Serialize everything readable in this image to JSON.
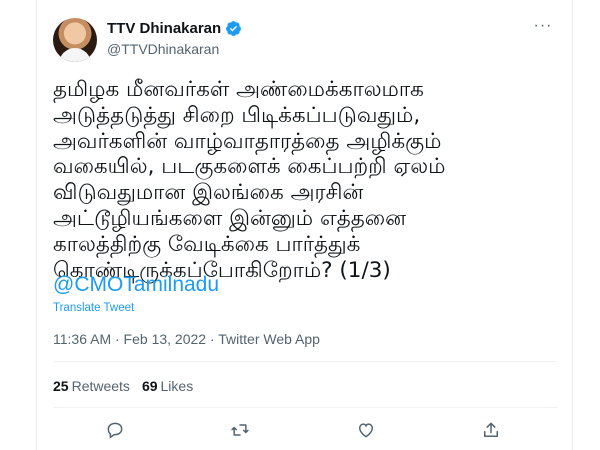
{
  "user": {
    "display_name": "TTV Dhinakaran",
    "handle": "@TTVDhinakaran"
  },
  "tweet": {
    "text": "தமிழக மீனவர்கள் அண்மைக்காலமாக\nஅடுத்தடுத்து சிறை பிடிக்கப்படுவதும்,\nஅவர்களின் வாழ்வாதாரத்தை அழிக்கும்\nவகையில், படகுகளைக் கைப்பற்றி ஏலம்\nவிடுவதுமான இலங்கை அரசின்\nஅட்டூழியங்களை இன்னும் எத்தனை\nகாலத்திற்கு வேடிக்கை பார்த்துக்\nகொண்டிருக்கப்போகிறோம்? (1/3)",
    "mention": "@CMOTamilnadu",
    "translate_label": "Translate Tweet",
    "meta": "11:36 AM · Feb 13, 2022 · Twitter Web App"
  },
  "stats": {
    "retweets_count": "25",
    "retweets_label": "Retweets",
    "likes_count": "69",
    "likes_label": "Likes"
  },
  "icons": {
    "verified": "verified-badge-icon",
    "more": "more-icon",
    "reply": "reply-icon",
    "retweet": "retweet-icon",
    "like": "like-icon",
    "share": "share-icon"
  },
  "colors": {
    "accent": "#1d9bf0",
    "text": "#0f1419",
    "muted": "#536471"
  }
}
